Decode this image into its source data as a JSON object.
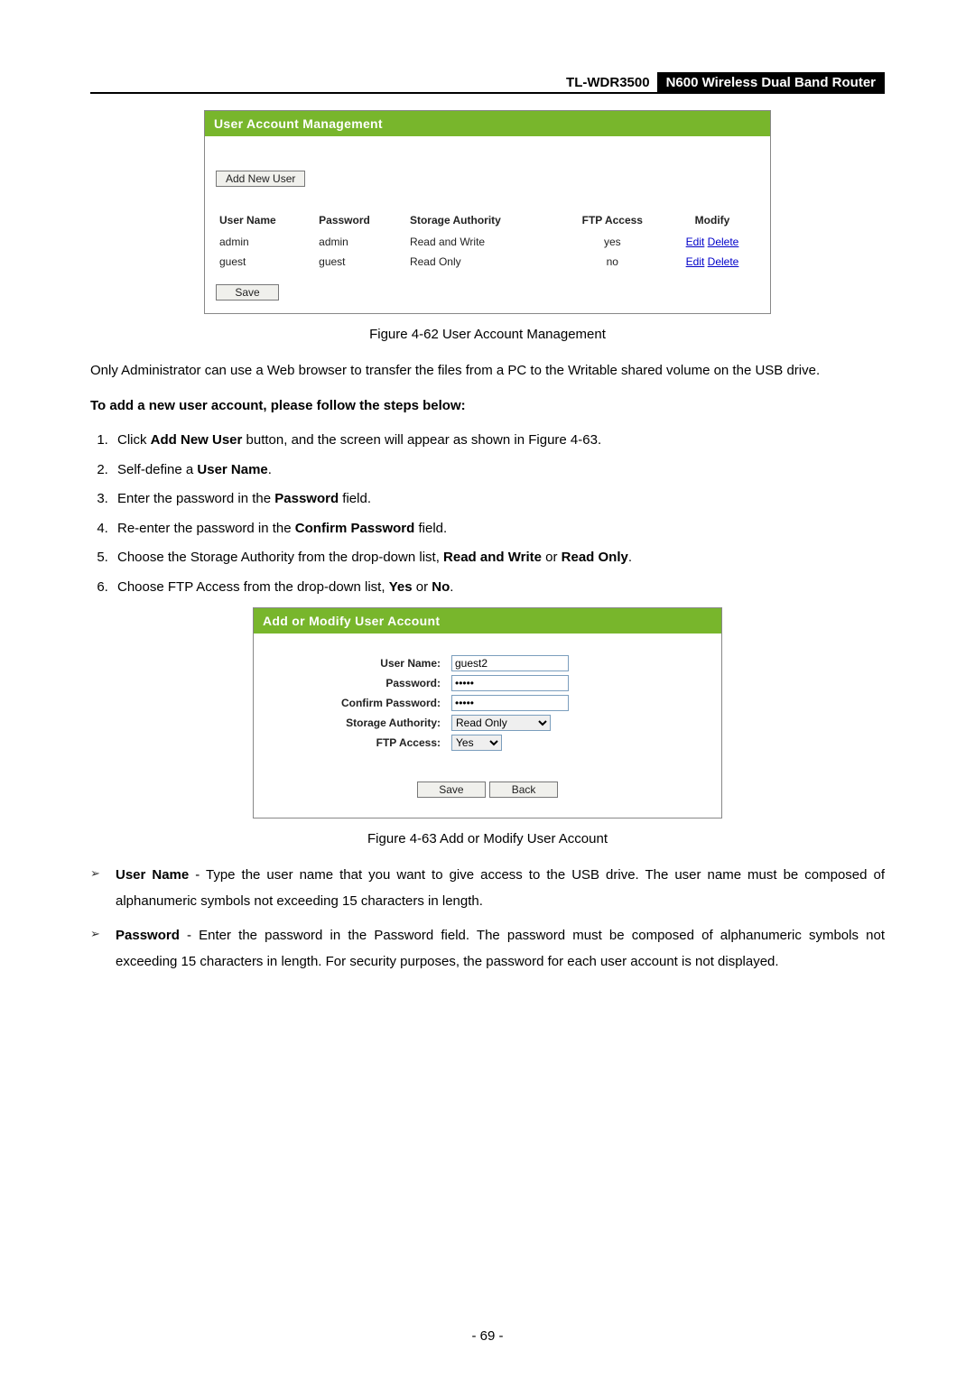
{
  "header": {
    "model": "TL-WDR3500",
    "product": "N600 Wireless Dual Band Router"
  },
  "panel1": {
    "title": "User Account Management",
    "add_btn": "Add New User",
    "cols": {
      "c1": "User Name",
      "c2": "Password",
      "c3": "Storage Authority",
      "c4": "FTP Access",
      "c5": "Modify"
    },
    "rows": [
      {
        "user": "admin",
        "pass": "admin",
        "auth": "Read and Write",
        "ftp": "yes",
        "edit": "Edit",
        "del": "Delete"
      },
      {
        "user": "guest",
        "pass": "guest",
        "auth": "Read Only",
        "ftp": "no",
        "edit": "Edit",
        "del": "Delete"
      }
    ],
    "save_btn": "Save"
  },
  "caption1": "Figure 4-62 User Account Management",
  "para1": "Only Administrator can use a Web browser to transfer the files from a PC to the Writable shared volume on the USB drive.",
  "heading_steps": "To add a new user account, please follow the steps below:",
  "steps": {
    "s1a": "Click ",
    "s1b": "Add New User",
    "s1c": " button, and the screen will appear as shown in Figure 4-63.",
    "s2a": "Self-define a ",
    "s2b": "User Name",
    "s2c": ".",
    "s3a": "Enter the password in the ",
    "s3b": "Password",
    "s3c": " field.",
    "s4a": "Re-enter the password in the ",
    "s4b": "Confirm Password",
    "s4c": " field.",
    "s5a": "Choose the Storage Authority from the drop-down list, ",
    "s5b": "Read and Write",
    "s5c": " or ",
    "s5d": "Read Only",
    "s5e": ".",
    "s6a": "Choose FTP Access from the drop-down list, ",
    "s6b": "Yes",
    "s6c": " or ",
    "s6d": "No",
    "s6e": "."
  },
  "panel2": {
    "title": "Add or Modify User Account",
    "labels": {
      "uname": "User Name:",
      "pass": "Password:",
      "cpass": "Confirm Password:",
      "auth": "Storage Authority:",
      "ftp": "FTP Access:"
    },
    "values": {
      "uname": "guest2",
      "pass": "•••••",
      "cpass": "•••••",
      "auth": "Read Only",
      "ftp": "Yes"
    },
    "save_btn": "Save",
    "back_btn": "Back"
  },
  "caption2": "Figure 4-63 Add or Modify User Account",
  "bullets": {
    "b1_label": "User Name",
    "b1_sep": " - ",
    "b1_text": "Type the user name that you want to give access to the USB drive. The user name must be composed of alphanumeric symbols not exceeding 15 characters in length.",
    "b2_label": "Password",
    "b2_sep": " - ",
    "b2_text": "Enter the password in the Password field. The password must be composed of alphanumeric symbols not exceeding 15 characters in length. For security purposes, the password for each user account is not displayed."
  },
  "page_num": "- 69 -"
}
